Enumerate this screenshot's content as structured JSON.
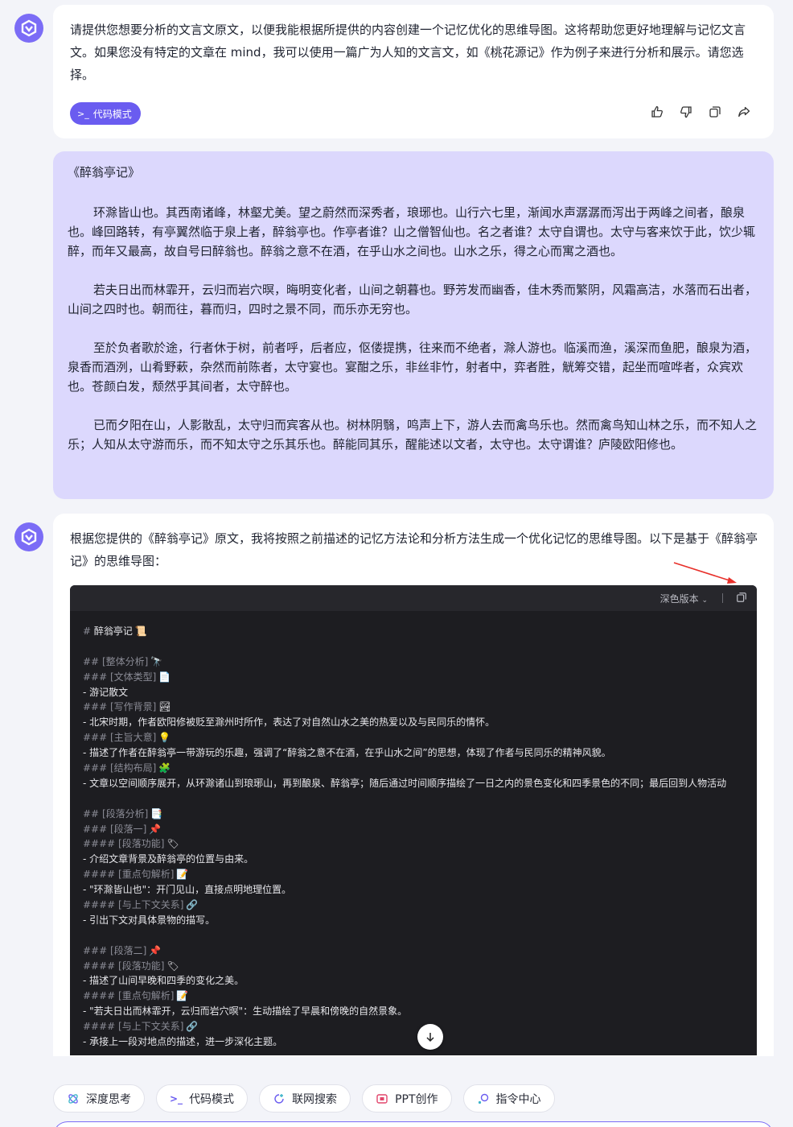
{
  "colors": {
    "accent": "#6a5cf0",
    "user_bubble": "#dcd8fd",
    "code_bg": "#1d1d21",
    "annotation": "#e8302a"
  },
  "message1": {
    "text": "请提供您想要分析的文言文原文，以便我能根据所提供的内容创建一个记忆优化的思维导图。这将帮助您更好地理解与记忆文言文。如果您没有特定的文章在 mind，我可以使用一篇广为人知的文言文，如《桃花源记》作为例子来进行分析和展示。请您选择。",
    "mode_tag": "代码模式",
    "actions": [
      "thumbs-up-icon",
      "thumbs-down-icon",
      "copy-icon",
      "share-icon"
    ]
  },
  "user_message": {
    "title": "《醉翁亭记》",
    "paragraphs": [
      "环滁皆山也。其西南诸峰，林壑尤美。望之蔚然而深秀者，琅琊也。山行六七里，渐闻水声潺潺而泻出于两峰之间者，酿泉也。峰回路转，有亭翼然临于泉上者，醉翁亭也。作亭者谁？山之僧智仙也。名之者谁？太守自谓也。太守与客来饮于此，饮少辄醉，而年又最高，故自号曰醉翁也。醉翁之意不在酒，在乎山水之间也。山水之乐，得之心而寓之酒也。",
      "若夫日出而林霏开，云归而岩穴暝，晦明变化者，山间之朝暮也。野芳发而幽香，佳木秀而繁阴，风霜高洁，水落而石出者，山间之四时也。朝而往，暮而归，四时之景不同，而乐亦无穷也。",
      "至於负者歌於途，行者休于树，前者呼，后者应，伛偻提携，往来而不绝者，滁人游也。临溪而渔，溪深而鱼肥，酿泉为酒，泉香而酒洌，山肴野蔌，杂然而前陈者，太守宴也。宴酣之乐，非丝非竹，射者中，弈者胜，觥筹交错，起坐而喧哗者，众宾欢也。苍颜白发，颓然乎其间者，太守醉也。",
      "已而夕阳在山，人影散乱，太守归而宾客从也。树林阴翳，鸣声上下，游人去而禽鸟乐也。然而禽鸟知山林之乐，而不知人之乐；人知从太守游而乐，而不知太守之乐其乐也。醉能同其乐，醒能述以文者，太守也。太守谓谁？庐陵欧阳修也。"
    ]
  },
  "message2": {
    "intro": "根据您提供的《醉翁亭记》原文，我将按照之前描述的记忆方法论和分析方法生成一个优化记忆的思维导图。以下是基于《醉翁亭记》的思维导图：",
    "code_theme": "深色版本",
    "code_lines": [
      {
        "h": "# ",
        "t": "醉翁亭记",
        "e": "📜"
      },
      {
        "h": "",
        "t": "",
        "e": ""
      },
      {
        "h": "## ",
        "t": "[整体分析]",
        "e": "🔭",
        "dim": true
      },
      {
        "h": "### ",
        "t": "[文体类型]",
        "e": "📄",
        "dim": true
      },
      {
        "h": "",
        "t": "- 游记散文",
        "e": ""
      },
      {
        "h": "### ",
        "t": "[写作背景]",
        "e": "🏞",
        "dim": true
      },
      {
        "h": "",
        "t": "- 北宋时期，作者欧阳修被贬至滁州时所作，表达了对自然山水之美的热爱以及与民同乐的情怀。",
        "e": ""
      },
      {
        "h": "### ",
        "t": "[主旨大意]",
        "e": "💡",
        "dim": true
      },
      {
        "h": "",
        "t": "- 描述了作者在醉翁亭一带游玩的乐趣，强调了“醉翁之意不在酒，在乎山水之间”的思想，体现了作者与民同乐的精神风貌。",
        "e": ""
      },
      {
        "h": "### ",
        "t": "[结构布局]",
        "e": "🧩",
        "dim": true
      },
      {
        "h": "",
        "t": "- 文章以空间顺序展开，从环滁诸山到琅琊山，再到酿泉、醉翁亭；随后通过时间顺序描绘了一日之内的景色变化和四季景色的不同；最后回到人物活动",
        "e": ""
      },
      {
        "h": "",
        "t": "",
        "e": ""
      },
      {
        "h": "## ",
        "t": "[段落分析]",
        "e": "📑",
        "dim": true
      },
      {
        "h": "### ",
        "t": "[段落一]",
        "e": "📌",
        "dim": true
      },
      {
        "h": "#### ",
        "t": "[段落功能]",
        "e": "🏷",
        "dim": true
      },
      {
        "h": "",
        "t": "- 介绍文章背景及醉翁亭的位置与由来。",
        "e": ""
      },
      {
        "h": "#### ",
        "t": "[重点句解析]",
        "e": "📝",
        "dim": true
      },
      {
        "h": "",
        "t": "- \"环滁皆山也\"：开门见山，直接点明地理位置。",
        "e": ""
      },
      {
        "h": "#### ",
        "t": "[与上下文关系]",
        "e": "🔗",
        "dim": true
      },
      {
        "h": "",
        "t": "- 引出下文对具体景物的描写。",
        "e": ""
      },
      {
        "h": "",
        "t": "",
        "e": ""
      },
      {
        "h": "### ",
        "t": "[段落二]",
        "e": "📌",
        "dim": true
      },
      {
        "h": "#### ",
        "t": "[段落功能]",
        "e": "🏷",
        "dim": true
      },
      {
        "h": "",
        "t": "- 描述了山间早晚和四季的变化之美。",
        "e": ""
      },
      {
        "h": "#### ",
        "t": "[重点句解析]",
        "e": "📝",
        "dim": true
      },
      {
        "h": "",
        "t": "- \"若夫日出而林霏开，云归而岩穴暝\"：生动描绘了早晨和傍晚的自然景象。",
        "e": ""
      },
      {
        "h": "#### ",
        "t": "[与上下文关系]",
        "e": "🔗",
        "dim": true
      },
      {
        "h": "",
        "t": "- 承接上一段对地点的描述，进一步深化主题。",
        "e": ""
      }
    ]
  },
  "bottom_bar": [
    {
      "label": "深度思考",
      "icon": "deep-think-icon"
    },
    {
      "label": "代码模式",
      "icon": "code-mode-icon"
    },
    {
      "label": "联网搜索",
      "icon": "web-search-icon"
    },
    {
      "label": "PPT创作",
      "icon": "ppt-icon"
    },
    {
      "label": "指令中心",
      "icon": "command-center-icon"
    }
  ]
}
